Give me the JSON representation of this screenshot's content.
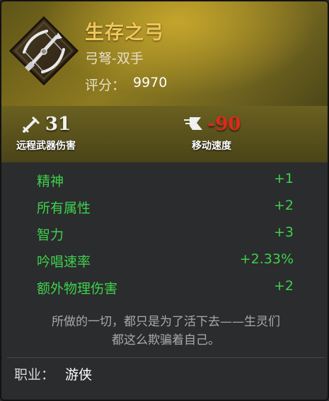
{
  "item": {
    "name": "生存之弓",
    "type": "弓弩-双手",
    "score_label": "评分：",
    "score_value": "9970",
    "icon": "crossbow-icon",
    "rarity_color": "#f1c55a"
  },
  "primary_stats": [
    {
      "icon": "ranged-weapon-icon",
      "value": "31",
      "label": "远程武器伤害",
      "color": "#f2f2f2"
    },
    {
      "icon": "move-speed-icon",
      "value": "-90",
      "label": "移动速度",
      "color": "#e0281e"
    }
  ],
  "stats": [
    {
      "name": "精神",
      "value": "+1"
    },
    {
      "name": "所有属性",
      "value": "+2"
    },
    {
      "name": "智力",
      "value": "+3"
    },
    {
      "name": "吟唱速率",
      "value": "+2.33%"
    },
    {
      "name": "额外物理伤害",
      "value": "+2"
    }
  ],
  "stat_color": "#3ed14c",
  "lore": {
    "line1": "所做的一切，都只是为了活下去——生灵们",
    "line2": "都这么欺骗着自己。"
  },
  "class": {
    "label": "职业：",
    "value": "游侠"
  }
}
